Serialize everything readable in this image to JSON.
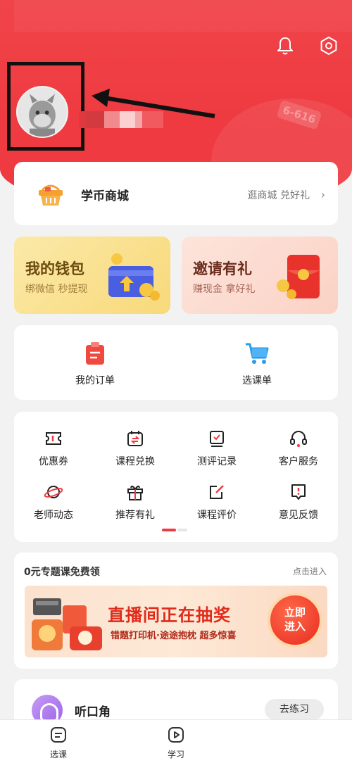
{
  "shop": {
    "title": "学币商城",
    "link": "逛商城 兑好礼"
  },
  "promos": [
    {
      "title": "我的钱包",
      "subtitle": "绑微信 秒提现"
    },
    {
      "title": "邀请有礼",
      "subtitle": "赚现金 拿好礼"
    }
  ],
  "orders": [
    {
      "label": "我的订单"
    },
    {
      "label": "选课单"
    }
  ],
  "tools": [
    {
      "label": "优惠券",
      "icon": "coupon-icon"
    },
    {
      "label": "课程兑换",
      "icon": "exchange-icon"
    },
    {
      "label": "测评记录",
      "icon": "assessment-icon"
    },
    {
      "label": "客户服务",
      "icon": "headset-icon"
    },
    {
      "label": "老师动态",
      "icon": "planet-icon"
    },
    {
      "label": "推荐有礼",
      "icon": "gift-icon"
    },
    {
      "label": "课程评价",
      "icon": "edit-icon"
    },
    {
      "label": "意见反馈",
      "icon": "feedback-icon"
    }
  ],
  "free_course": {
    "title": "0元专题课免费领",
    "link": "点击进入",
    "banner_main": "直播间正在抽奖",
    "banner_sub": "错题打印机·途途抱枕 超多惊喜",
    "banner_btn_line1": "立即",
    "banner_btn_line2": "进入"
  },
  "listen": {
    "title": "听口角",
    "button": "去练习"
  },
  "tabs": [
    {
      "label": "选课"
    },
    {
      "label": "学习"
    }
  ],
  "colors": {
    "accent": "#ee3a40",
    "wallet_bg": "#f8d97a",
    "invite_bg": "#fbd2c5"
  }
}
